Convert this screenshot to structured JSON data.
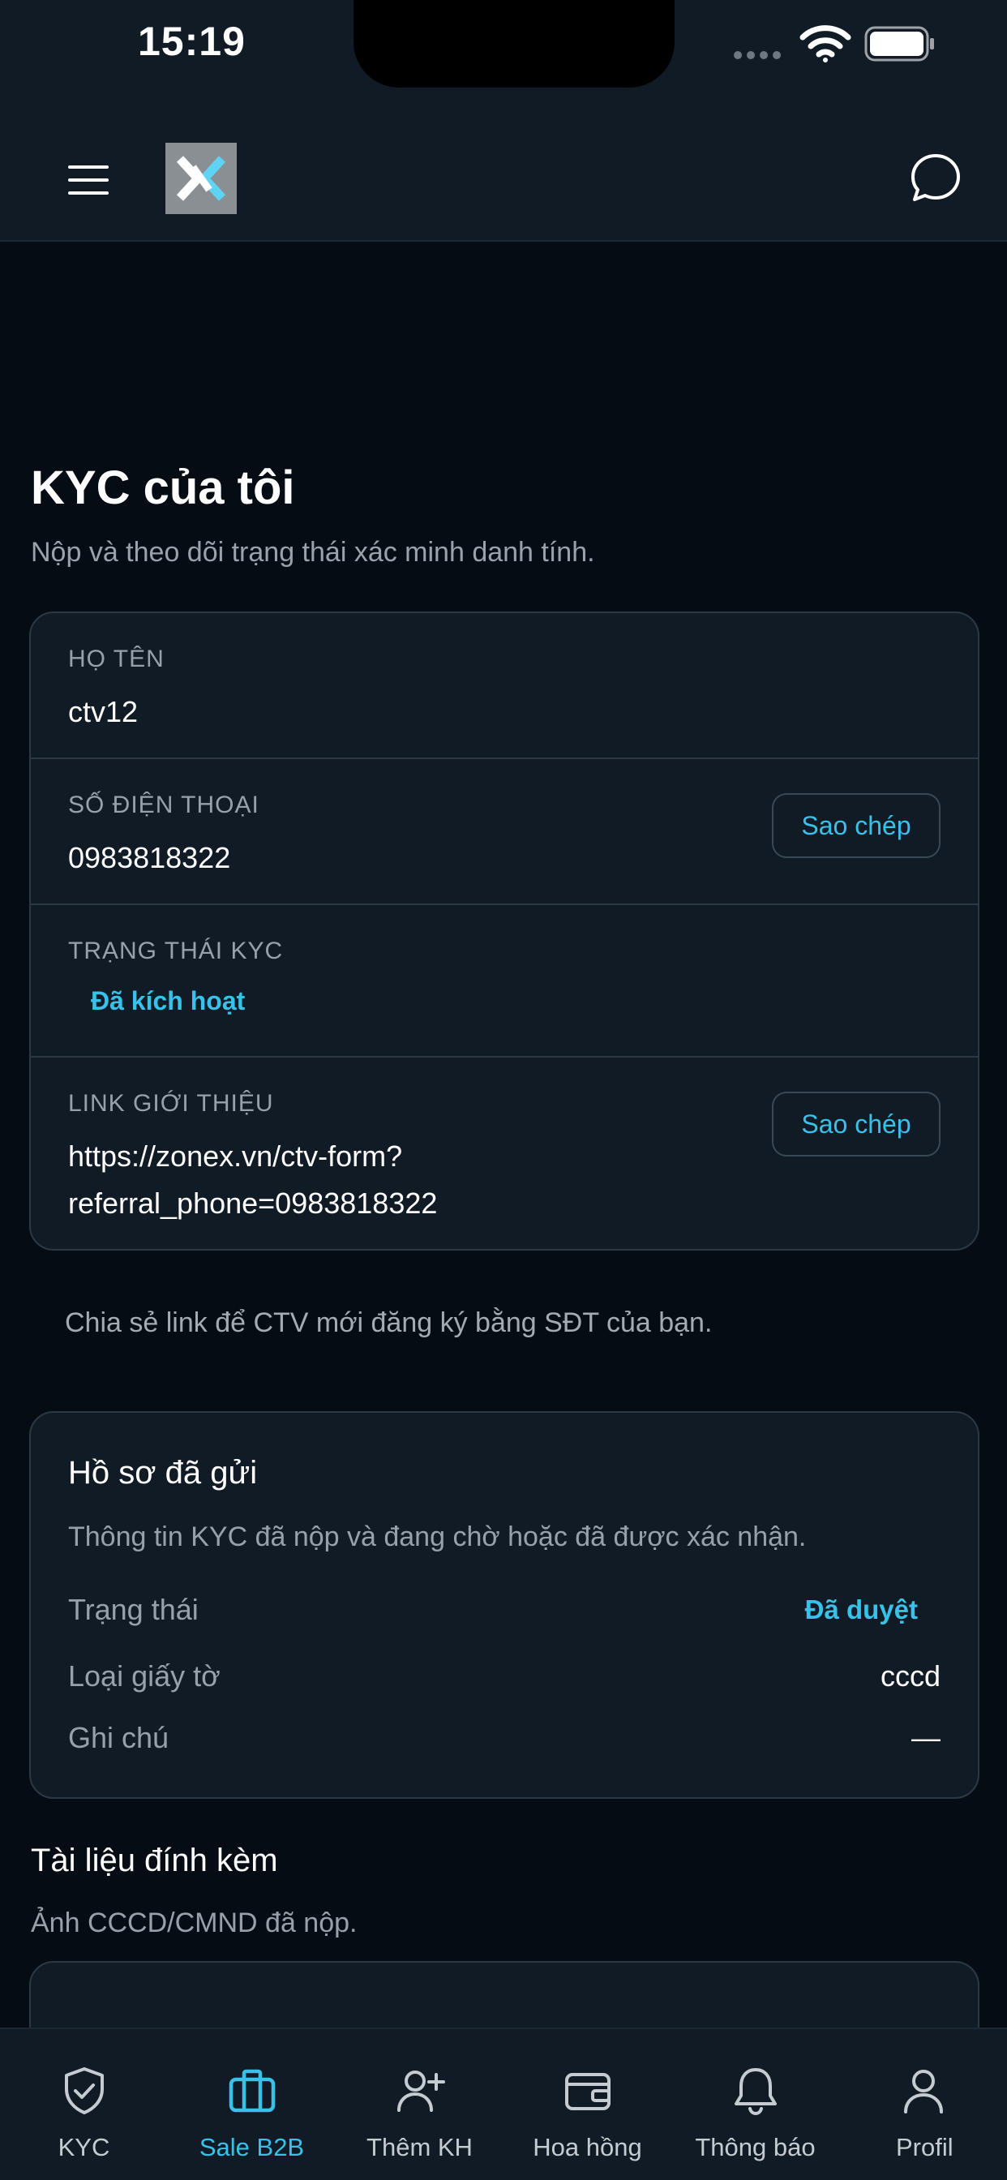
{
  "status_bar": {
    "time": "15:19"
  },
  "header": {
    "logo_letter": "X",
    "icons": [
      "menu-icon",
      "chat-bubble-icon"
    ]
  },
  "page": {
    "title": "KYC của tôi",
    "subtitle": "Nộp và theo dõi trạng thái xác minh danh tính."
  },
  "info": {
    "name_label": "HỌ TÊN",
    "name_value": "ctv12",
    "phone_label": "SỐ ĐIỆN THOẠI",
    "phone_value": "0983818322",
    "kyc_label": "TRẠNG THÁI KYC",
    "kyc_status": "Đã kích hoạt",
    "link_label": "LINK GIỚI THIỆU",
    "link_line1": "https://zonex.vn/ctv-form?",
    "link_line2": "referral_phone=0983818322",
    "copy_label": "Sao chép"
  },
  "share_note": "Chia sẻ link để CTV mới đăng ký bằng SĐT của bạn.",
  "profile": {
    "title": "Hồ sơ đã gửi",
    "description": "Thông tin KYC đã nộp và đang chờ hoặc đã được xác nhận.",
    "status_label": "Trạng thái",
    "status_value": "Đã duyệt",
    "doc_type_label": "Loại giấy tờ",
    "doc_type_value": "cccd",
    "note_label": "Ghi chú",
    "note_value": "—"
  },
  "attachments": {
    "title": "Tài liệu đính kèm",
    "subtitle": "Ảnh CCCD/CMND đã nộp."
  },
  "bottom_nav": {
    "active": "Sale B2B",
    "accent_color": "#38c2ea",
    "items": [
      {
        "label": "KYC",
        "icon": "shield-check-icon"
      },
      {
        "label": "Sale B2B",
        "icon": "briefcase-icon"
      },
      {
        "label": "Thêm KH",
        "icon": "user-plus-icon"
      },
      {
        "label": "Hoa hồng",
        "icon": "wallet-icon"
      },
      {
        "label": "Thông báo",
        "icon": "bell-icon"
      },
      {
        "label": "Profil",
        "icon": "user-icon"
      }
    ]
  }
}
